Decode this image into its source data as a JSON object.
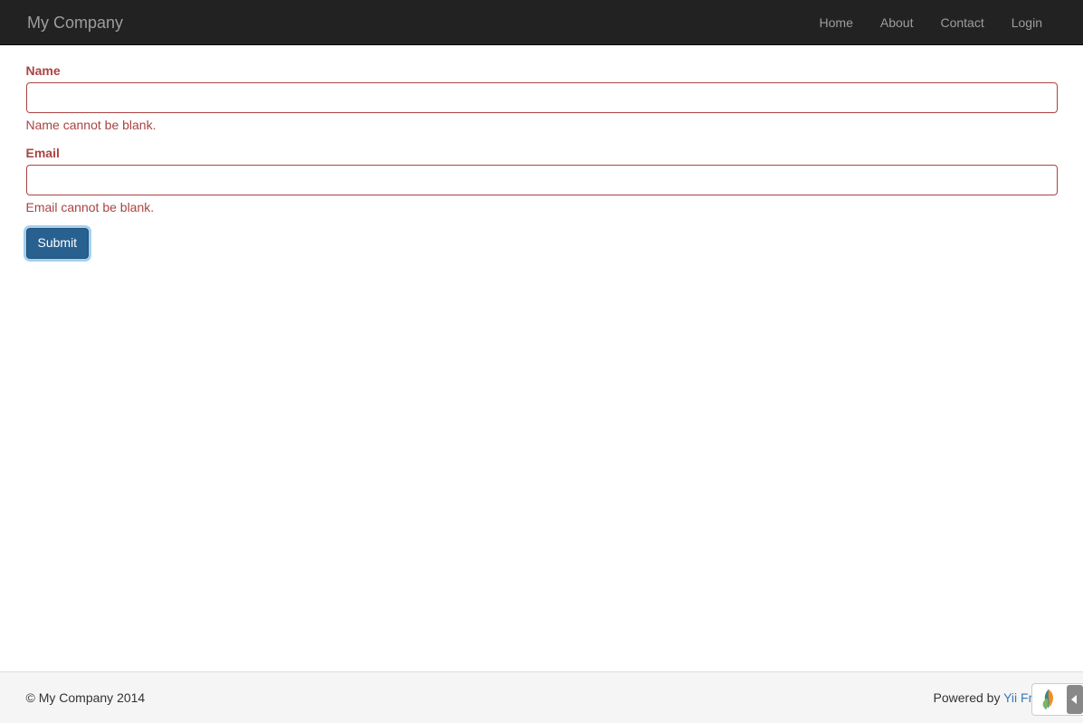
{
  "navbar": {
    "brand": "My Company",
    "items": [
      {
        "label": "Home"
      },
      {
        "label": "About"
      },
      {
        "label": "Contact"
      },
      {
        "label": "Login"
      }
    ]
  },
  "form": {
    "name": {
      "label": "Name",
      "value": "",
      "error": "Name cannot be blank."
    },
    "email": {
      "label": "Email",
      "value": "",
      "error": "Email cannot be blank."
    },
    "submit_label": "Submit"
  },
  "footer": {
    "copyright": "© My Company 2014",
    "powered_prefix": "Powered by ",
    "powered_link": "Yii Frame"
  }
}
